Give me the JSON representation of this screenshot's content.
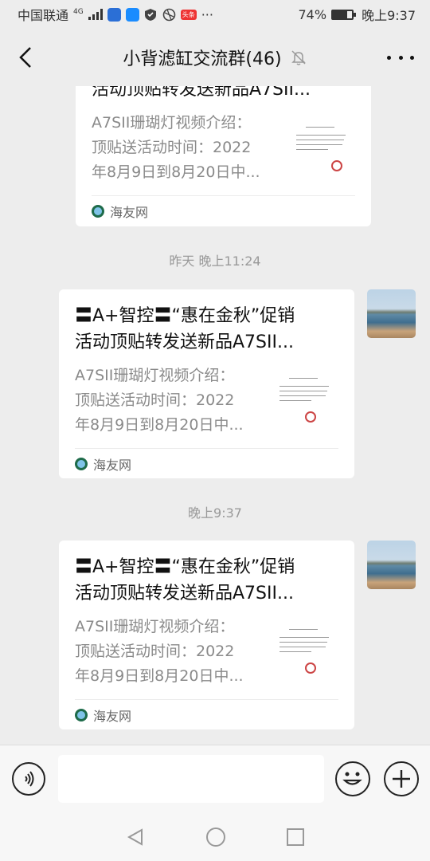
{
  "status_bar": {
    "carrier": "中国联通",
    "network": "4G",
    "badge_label": "头条",
    "more": "···",
    "battery": "74%",
    "battery_level": 0.74,
    "time": "晚上9:37"
  },
  "header": {
    "title": "小背滤缸交流群(46)",
    "mute_icon": "bell-off-icon",
    "more_icon": "more-dots-icon"
  },
  "messages": [
    {
      "title_line1": "",
      "title_line2": "活动顶贴转发送新品A7SII...",
      "desc_lines": [
        "A7SII珊瑚灯视频介绍：",
        "顶贴送活动时间：2022",
        "年8月9日到8月20日中..."
      ],
      "source": "海友网"
    },
    {
      "time": "昨天 晚上11:24",
      "title_line1": "〓A+智控〓“惠在金秋”促销",
      "title_line2": "活动顶贴转发送新品A7SII...",
      "desc_lines": [
        "A7SII珊瑚灯视频介绍：",
        "顶贴送活动时间：2022",
        "年8月9日到8月20日中..."
      ],
      "source": "海友网"
    },
    {
      "time": "晚上9:37",
      "title_line1": "〓A+智控〓“惠在金秋”促销",
      "title_line2": "活动顶贴转发送新品A7SII...",
      "desc_lines": [
        "A7SII珊瑚灯视频介绍：",
        "顶贴送活动时间：2022",
        "年8月9日到8月20日中..."
      ],
      "source": "海友网"
    }
  ],
  "input_bar": {
    "voice_icon": "voice-icon",
    "emoji_icon": "emoji-icon",
    "plus_icon": "plus-icon",
    "message_value": ""
  },
  "nav_bar": {
    "back_icon": "nav-back-icon",
    "home_icon": "nav-home-icon",
    "recent_icon": "nav-recent-icon"
  }
}
